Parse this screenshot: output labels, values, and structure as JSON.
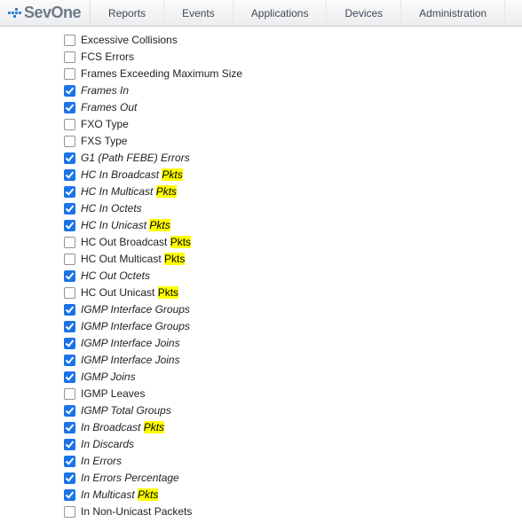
{
  "brand": "SevOne",
  "nav": [
    "Reports",
    "Events",
    "Applications",
    "Devices",
    "Administration"
  ],
  "highlight_token": "Pkts",
  "items": [
    {
      "label": "Excessive Collisions",
      "checked": false,
      "italic": false
    },
    {
      "label": "FCS Errors",
      "checked": false,
      "italic": false
    },
    {
      "label": "Frames Exceeding Maximum Size",
      "checked": false,
      "italic": false
    },
    {
      "label": "Frames In",
      "checked": true,
      "italic": true
    },
    {
      "label": "Frames Out",
      "checked": true,
      "italic": true
    },
    {
      "label": "FXO Type",
      "checked": false,
      "italic": false
    },
    {
      "label": "FXS Type",
      "checked": false,
      "italic": false
    },
    {
      "label": "G1 (Path FEBE) Errors",
      "checked": true,
      "italic": true
    },
    {
      "label": "HC In Broadcast Pkts",
      "checked": true,
      "italic": true
    },
    {
      "label": "HC In Multicast Pkts",
      "checked": true,
      "italic": true
    },
    {
      "label": "HC In Octets",
      "checked": true,
      "italic": true
    },
    {
      "label": "HC In Unicast Pkts",
      "checked": true,
      "italic": true
    },
    {
      "label": "HC Out Broadcast Pkts",
      "checked": false,
      "italic": false
    },
    {
      "label": "HC Out Multicast Pkts",
      "checked": false,
      "italic": false
    },
    {
      "label": "HC Out Octets",
      "checked": true,
      "italic": true
    },
    {
      "label": "HC Out Unicast Pkts",
      "checked": false,
      "italic": false
    },
    {
      "label": "IGMP Interface Groups",
      "checked": true,
      "italic": true
    },
    {
      "label": "IGMP Interface Groups",
      "checked": true,
      "italic": true
    },
    {
      "label": "IGMP Interface Joins",
      "checked": true,
      "italic": true
    },
    {
      "label": "IGMP Interface Joins",
      "checked": true,
      "italic": true
    },
    {
      "label": "IGMP Joins",
      "checked": true,
      "italic": true
    },
    {
      "label": "IGMP Leaves",
      "checked": false,
      "italic": false
    },
    {
      "label": "IGMP Total Groups",
      "checked": true,
      "italic": true
    },
    {
      "label": "In Broadcast Pkts",
      "checked": true,
      "italic": true
    },
    {
      "label": "In Discards",
      "checked": true,
      "italic": true
    },
    {
      "label": "In Errors",
      "checked": true,
      "italic": true
    },
    {
      "label": "In Errors Percentage",
      "checked": true,
      "italic": true
    },
    {
      "label": "In Multicast Pkts",
      "checked": true,
      "italic": true
    },
    {
      "label": "In Non-Unicast Packets",
      "checked": false,
      "italic": false
    }
  ]
}
